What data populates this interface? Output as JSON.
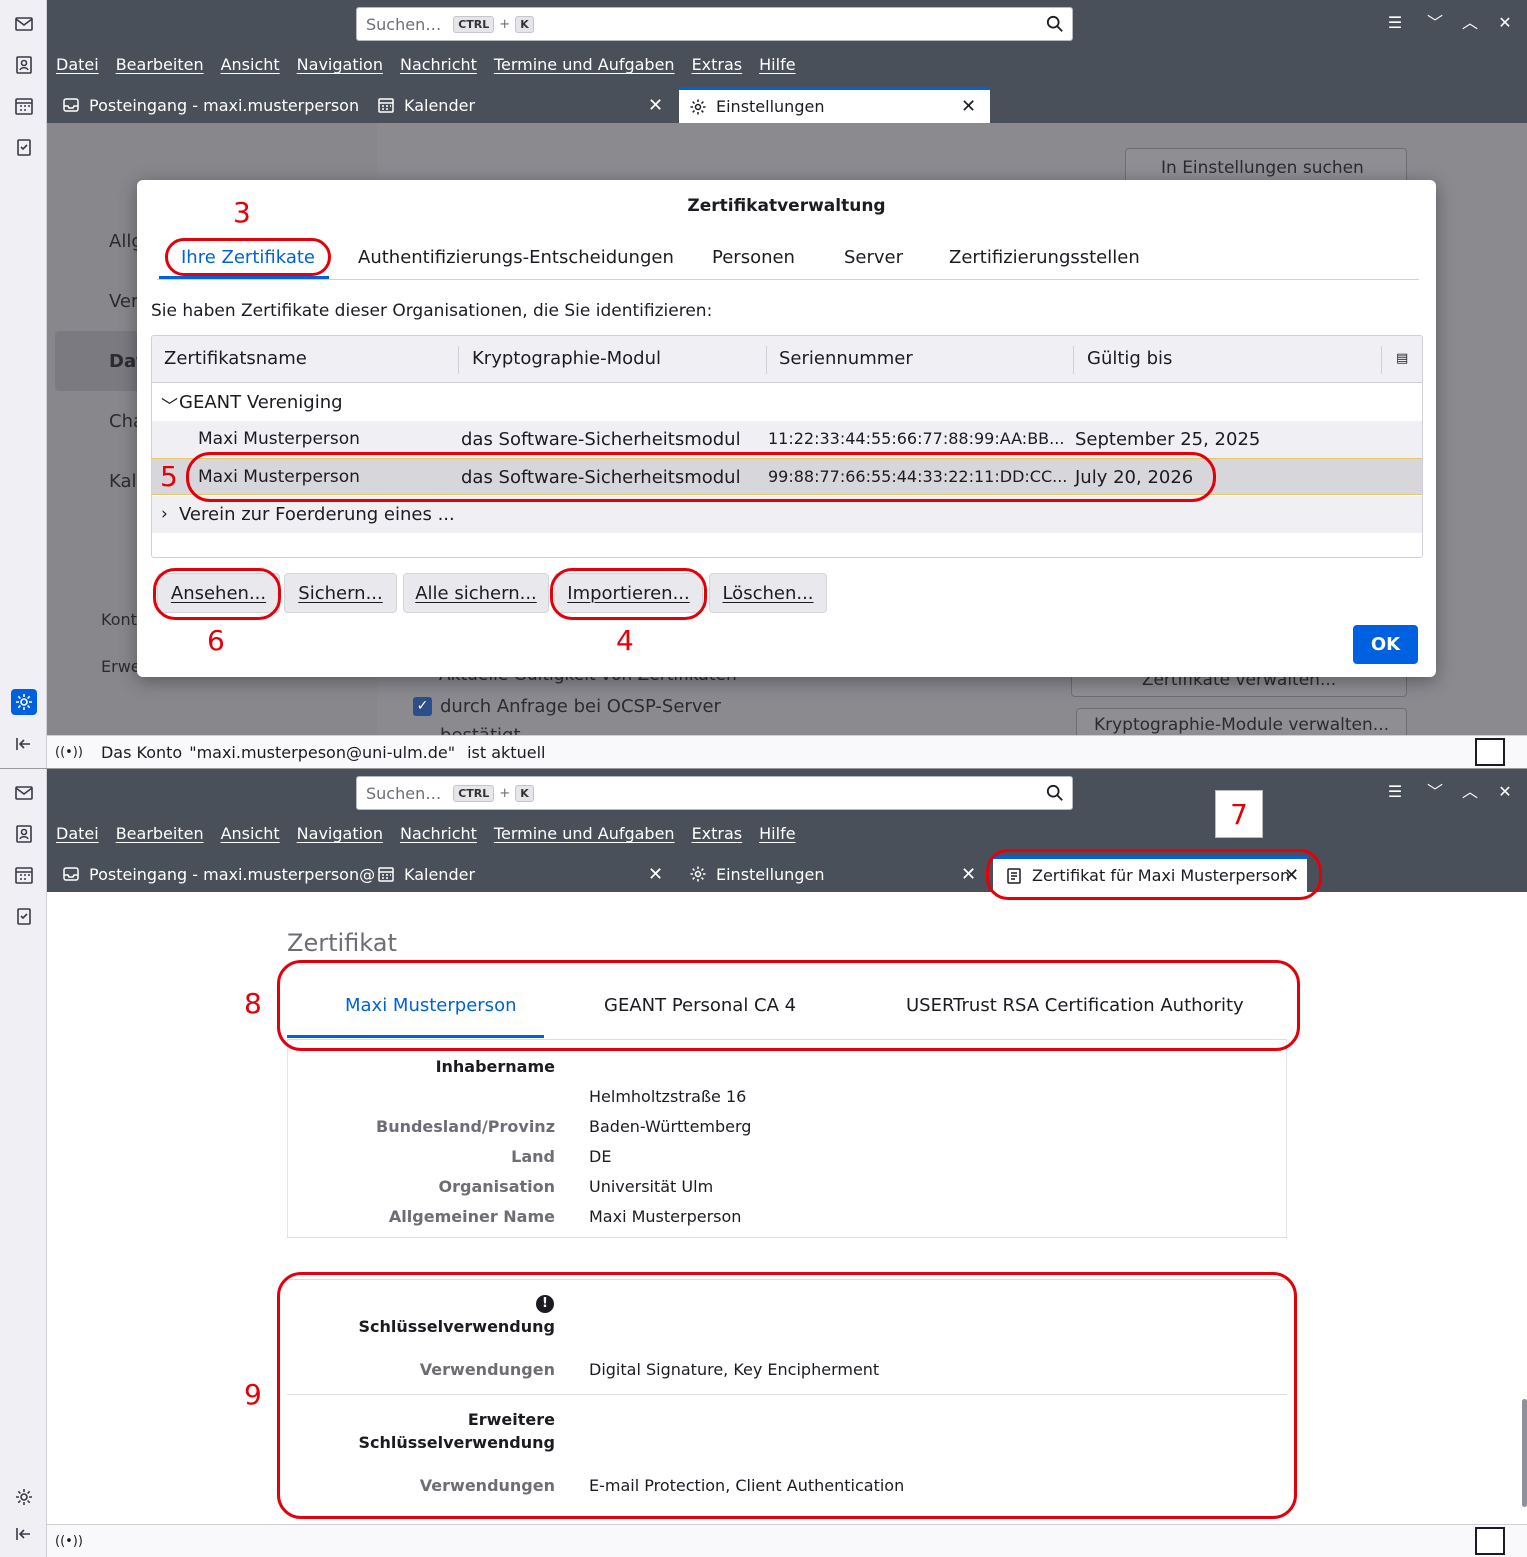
{
  "search": {
    "placeholder": "Suchen…",
    "key1": "CTRL",
    "plus": "+",
    "key2": "K"
  },
  "menu": [
    "Datei",
    "Bearbeiten",
    "Ansicht",
    "Navigation",
    "Nachricht",
    "Termine und Aufgaben",
    "Extras",
    "Hilfe"
  ],
  "window1": {
    "tabs": {
      "inbox_prefix": "Posteingang - ",
      "inbox_account": "maxi.musterperson",
      "calendar": "Kalender",
      "settings": "Einstellungen"
    },
    "settings_search": "In Einstellungen suchen",
    "bg_sidebar": [
      "Allg",
      "Ver",
      "Dat",
      "Cha",
      "Kal"
    ],
    "bg_sidebar_bottom": [
      "Kont",
      "Erwe"
    ],
    "bg_text": {
      "valid": "Aktuelle Gültigkeit von Zertifikaten",
      "ocsp": "durch Anfrage bei OCSP-Server",
      "manage": "Zertifikate verwalten...",
      "crypto": "Kryptographie-Module verwalten...",
      "partial": "bestätigt"
    },
    "dialog": {
      "title": "Zertifikatverwaltung",
      "tabs": [
        "Ihre Zertifikate",
        "Authentifizierungs-Entscheidungen",
        "Personen",
        "Server",
        "Zertifizierungsstellen"
      ],
      "description": "Sie haben Zertifikate dieser Organisationen, die Sie identifizieren:",
      "columns": [
        "Zertifikatsname",
        "Kryptographie-Modul",
        "Seriennummer",
        "Gültig bis"
      ],
      "group1": "GEANT Vereniging",
      "rows": [
        {
          "name": "Maxi Musterperson",
          "module": "das Software-Sicherheitsmodul",
          "serial": "11:22:33:44:55:66:77:88:99:AA:BB...",
          "valid": "September 25, 2025"
        },
        {
          "name": "Maxi Musterperson",
          "module": "das Software-Sicherheitsmodul",
          "serial": "99:88:77:66:55:44:33:22:11:DD:CC...",
          "valid": "July 20, 2026"
        }
      ],
      "group2": "Verein zur Foerderung eines ...",
      "buttons": [
        "Ansehen...",
        "Sichern...",
        "Alle sichern...",
        "Importieren...",
        "Löschen..."
      ],
      "ok": "OK"
    },
    "status": {
      "prefix": "Das Konto",
      "account": "\"maxi.musterpeson@uni-ulm.de\"",
      "suffix": "ist aktuell"
    }
  },
  "window2": {
    "tabs": {
      "inbox_prefix": "Posteingang - ",
      "inbox_account": "maxi.musterperson@",
      "calendar": "Kalender",
      "settings": "Einstellungen",
      "cert": "Zertifikat für Maxi Musterperson"
    },
    "page_title": "Zertifikat",
    "cert_tabs": [
      "Maxi Musterperson",
      "GEANT Personal CA 4",
      "USERTrust RSA Certification Authority"
    ],
    "subject_heading": "Inhabername",
    "subject": [
      {
        "label": "",
        "value": "Helmholtzstraße 16"
      },
      {
        "label": "Bundesland/Provinz",
        "value": "Baden-Württemberg"
      },
      {
        "label": "Land",
        "value": "DE"
      },
      {
        "label": "Organisation",
        "value": "Universität Ulm"
      },
      {
        "label": "Allgemeiner Name",
        "value": "Maxi Musterperson"
      }
    ],
    "key_usage_heading": "Schlüsselverwendung",
    "key_usage": {
      "label": "Verwendungen",
      "value": "Digital Signature, Key Encipherment"
    },
    "ext_heading_1": "Erweitere",
    "ext_heading_2": "Schlüsselverwendung",
    "ext_usage": {
      "label": "Verwendungen",
      "value": "E-mail Protection, Client Authentication"
    }
  },
  "annotations": [
    "3",
    "4",
    "5",
    "6",
    "7",
    "8",
    "9"
  ],
  "colors": {
    "accent": "#0061e0",
    "annotation": "#e3000b",
    "chrome": "#4a5059"
  }
}
